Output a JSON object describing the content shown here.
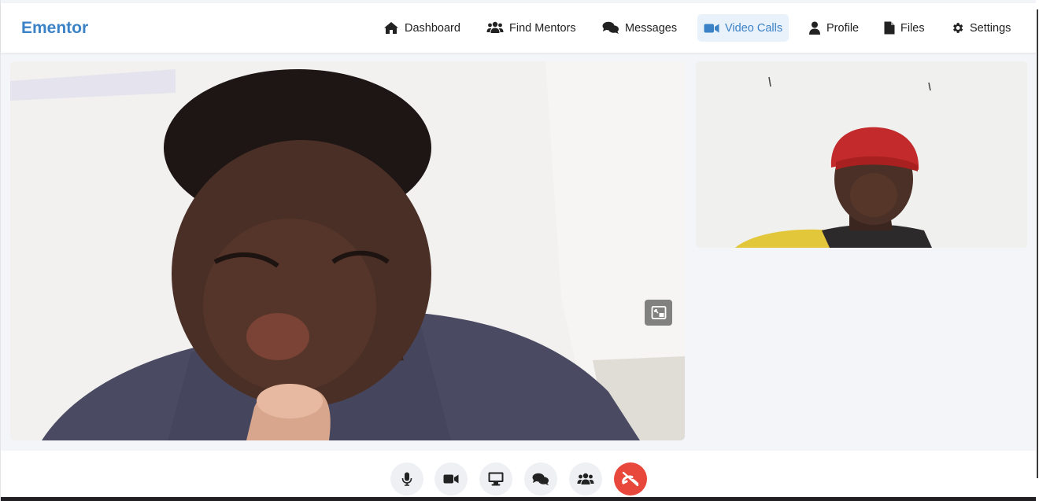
{
  "app": {
    "brand": "Ementor"
  },
  "nav": {
    "items": [
      {
        "label": "Dashboard",
        "icon": "home-icon",
        "active": false
      },
      {
        "label": "Find Mentors",
        "icon": "users-icon",
        "active": false
      },
      {
        "label": "Messages",
        "icon": "comments-icon",
        "active": false
      },
      {
        "label": "Video Calls",
        "icon": "video-icon",
        "active": true
      },
      {
        "label": "Profile",
        "icon": "user-icon",
        "active": false
      },
      {
        "label": "Files",
        "icon": "file-icon",
        "active": false
      },
      {
        "label": "Settings",
        "icon": "gear-icon",
        "active": false
      }
    ]
  },
  "video": {
    "main_stream": {
      "icon": "picture-in-picture-icon"
    },
    "side_stream": {}
  },
  "controls": {
    "buttons": [
      {
        "icon": "microphone-icon"
      },
      {
        "icon": "camera-icon"
      },
      {
        "icon": "screen-share-icon"
      },
      {
        "icon": "chat-icon"
      },
      {
        "icon": "participants-icon"
      },
      {
        "icon": "end-call-icon"
      }
    ]
  },
  "colors": {
    "brand": "#3b82c6",
    "active_nav_bg": "#e9f1fb",
    "end_call": "#e8473b",
    "control_bg": "#eef0f4"
  }
}
